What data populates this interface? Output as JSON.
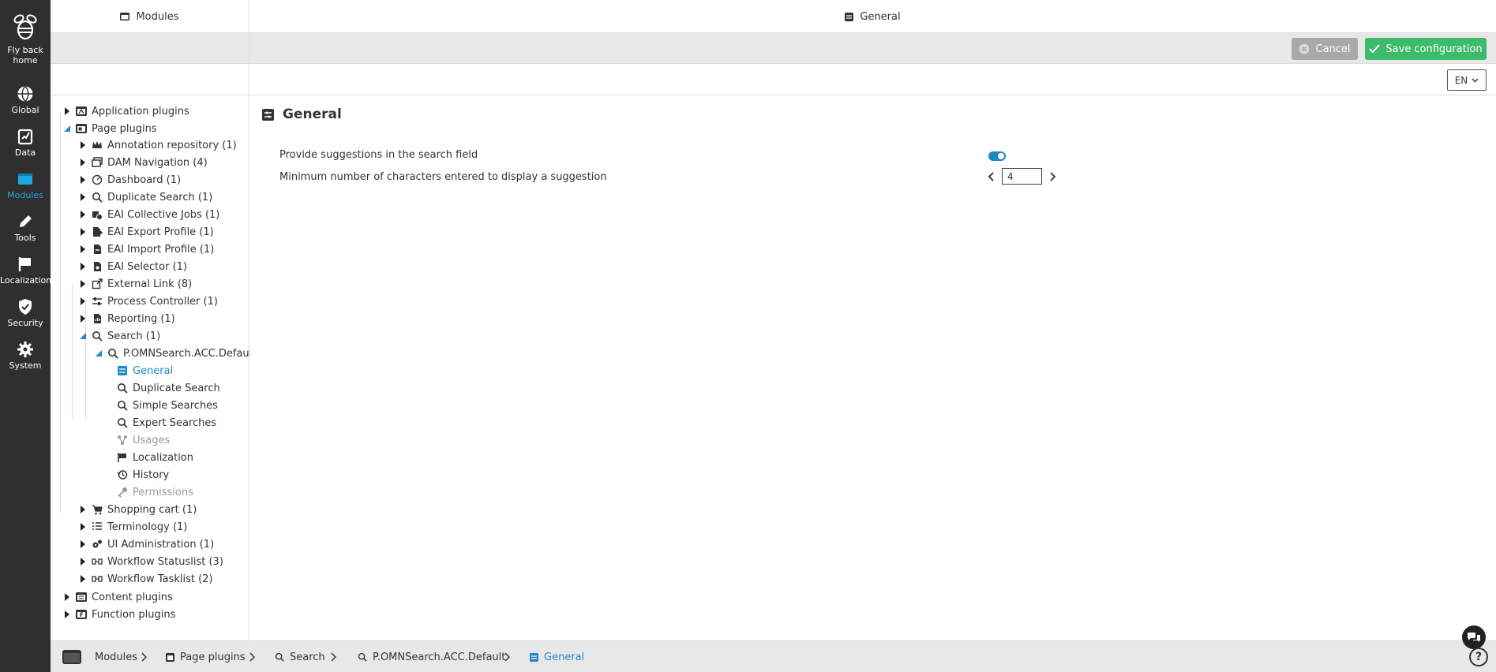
{
  "rail": {
    "items": [
      {
        "label1": "Fly back",
        "label2": "home",
        "icon": "bee-icon"
      },
      {
        "label1": "Global",
        "icon": "globe-icon"
      },
      {
        "label1": "Data",
        "icon": "data-icon"
      },
      {
        "label1": "Modules",
        "icon": "modules-icon",
        "active": true
      },
      {
        "label1": "Tools",
        "icon": "pencil-icon"
      },
      {
        "label1": "Localization",
        "icon": "flag-icon"
      },
      {
        "label1": "Security",
        "icon": "shield-icon"
      },
      {
        "label1": "System",
        "icon": "gear-icon"
      }
    ]
  },
  "header": {
    "left_title": "Modules",
    "right_title": "General"
  },
  "toolbar": {
    "cancel_label": "Cancel",
    "save_label": "Save configuration"
  },
  "language": {
    "selected": "EN"
  },
  "tree": {
    "application_plugins": "Application plugins",
    "page_plugins": "Page plugins",
    "page_children": [
      "Annotation repository (1)",
      "DAM Navigation (4)",
      "Dashboard (1)",
      "Duplicate Search (1)",
      "EAI Collective Jobs (1)",
      "EAI Export Profile (1)",
      "EAI Import Profile (1)",
      "EAI Selector (1)",
      "External Link (8)",
      "Process Controller (1)",
      "Reporting (1)",
      "Search (1)"
    ],
    "search_child": "P.OMNSearch.ACC.Default",
    "search_leaves": [
      "General",
      "Duplicate Search",
      "Simple Searches",
      "Expert Searches",
      "Usages",
      "Localization",
      "History",
      "Permissions"
    ],
    "page_children_after": [
      "Shopping cart (1)",
      "Terminology (1)",
      "UI Administration (1)",
      "Workflow Statuslist (3)",
      "Workflow Tasklist (2)"
    ],
    "content_plugins": "Content plugins",
    "function_plugins": "Function plugins"
  },
  "main": {
    "title": "General",
    "suggestions_label": "Provide suggestions in the search field",
    "suggestions_enabled": true,
    "min_chars_label": "Minimum number of characters entered to display a suggestion",
    "min_chars_value": "4"
  },
  "breadcrumb": [
    "Modules",
    "Page plugins",
    "Search",
    "P.OMNSearch.ACC.Default",
    "General"
  ],
  "colors": {
    "accent": "#1e88c7",
    "rail_bg": "#2f2f2f",
    "save_bg": "#3dbb6a",
    "cancel_bg": "#a9a9a9"
  }
}
